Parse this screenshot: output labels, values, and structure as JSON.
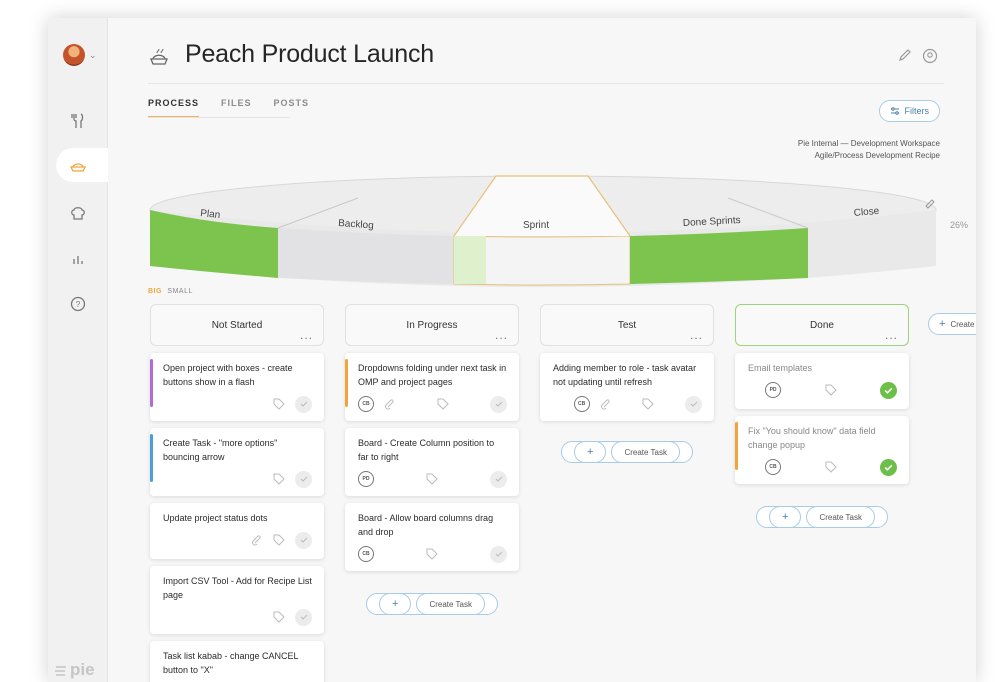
{
  "header": {
    "title": "Peach Product Launch"
  },
  "tabs": [
    {
      "label": "PROCESS"
    },
    {
      "label": "FILES"
    },
    {
      "label": "POSTS"
    }
  ],
  "filters": {
    "label": "Filters"
  },
  "workspace": {
    "line1": "Pie Internal — Development Workspace",
    "line2": "Agile/Process Development Recipe"
  },
  "process": {
    "stages": [
      {
        "label": "Plan"
      },
      {
        "label": "Backlog"
      },
      {
        "label": "Sprint"
      },
      {
        "label": "Done Sprints"
      },
      {
        "label": "Close"
      }
    ],
    "percent": "26%"
  },
  "board": {
    "size_big": "BIG",
    "size_small": "SMALL",
    "columns": [
      {
        "title": "Not Started",
        "dots": "...",
        "cards": [
          {
            "title": "Open project with boxes - create buttons show in a flash"
          },
          {
            "title": "Create Task - \"more options\" bouncing arrow"
          },
          {
            "title": "Update project status dots"
          },
          {
            "title": "Import CSV Tool - Add for Recipe List page"
          },
          {
            "title": "Task list kabab - change CANCEL button to \"X\""
          }
        ]
      },
      {
        "title": "In Progress",
        "dots": "...",
        "cards": [
          {
            "title": "Dropdowns folding under next task in OMP and project pages",
            "initials": "CB"
          },
          {
            "title": "Board - Create Column position to far to right",
            "initials": "PD"
          },
          {
            "title": "Board - Allow board columns drag and drop",
            "initials": "CB"
          }
        ],
        "create": "Create Task"
      },
      {
        "title": "Test",
        "dots": "...",
        "cards": [
          {
            "title": "Adding member to role - task avatar not updating until refresh",
            "initials": "CB"
          }
        ],
        "create": "Create Task"
      },
      {
        "title": "Done",
        "dots": "...",
        "cards": [
          {
            "title": "Email templates",
            "initials": "PD"
          },
          {
            "title": "Fix \"You should know\" data field change popup",
            "initials": "CB"
          }
        ],
        "create": "Create Task"
      }
    ],
    "create_column": "Create"
  },
  "brand": {
    "logo_text": "pie"
  },
  "colors": {
    "accent_green": "#7cc44d",
    "accent_orange": "#f0a43a",
    "accent_purple": "#b26bd6",
    "accent_blue": "#4a9ee0",
    "button_border": "#a8cbe6"
  }
}
